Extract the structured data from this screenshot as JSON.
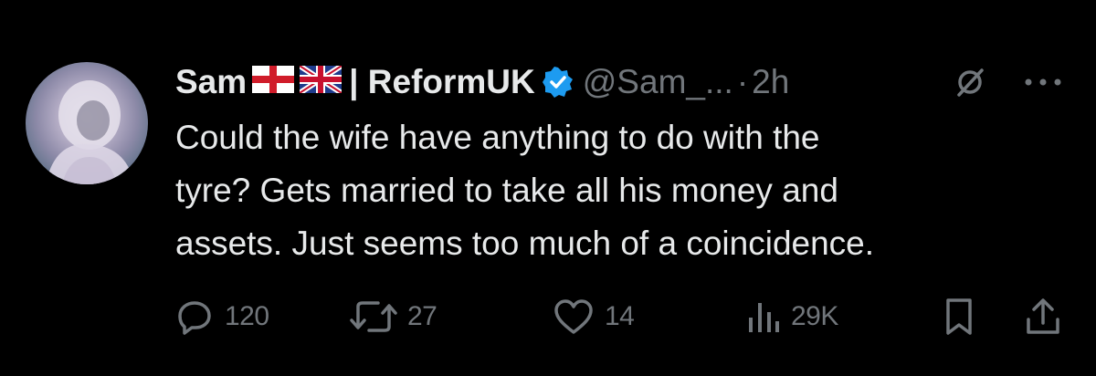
{
  "author": {
    "display_name": "Sam",
    "affiliation": "| ReformUK",
    "handle": "@Sam_...",
    "separator": "·",
    "time_ago": "2h"
  },
  "tweet": {
    "text": "Could the wife have anything to do with the\ntyre? Gets married to take all his money and\nassets. Just seems too much of a coincidence."
  },
  "metrics": {
    "replies": "120",
    "retweets": "27",
    "likes": "14",
    "views": "29K"
  },
  "icons": {
    "avatar": "avatar-image",
    "flag_1": "england-flag-icon",
    "flag_2": "union-jack-flag-icon",
    "verified": "verified-badge-icon",
    "grok": "grok-icon",
    "more": "more-icon",
    "reply": "reply-icon",
    "retweet": "retweet-icon",
    "like": "heart-icon",
    "views": "views-icon",
    "bookmark": "bookmark-icon",
    "share": "share-icon"
  },
  "colors": {
    "background": "#000000",
    "text": "#e7e9ea",
    "secondary": "#71767b",
    "verified": "#1d9bf0"
  }
}
